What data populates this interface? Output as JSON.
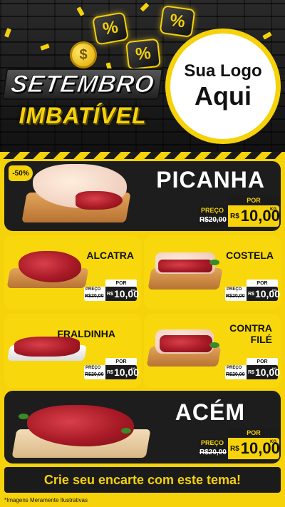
{
  "header": {
    "line1": "SETEMBRO",
    "line2": "IMBATÍVEL",
    "logo_line1": "Sua Logo",
    "logo_line2": "Aqui",
    "percent_symbol": "%",
    "coin_symbol": "$",
    "colors": {
      "accent": "#f5d20a",
      "dark": "#1b1b1b"
    }
  },
  "products": [
    {
      "name": "PICANHA",
      "badge": "-50%",
      "por": "POR",
      "preco": "PREÇO",
      "old": "R$20,00",
      "currency": "R$",
      "value": "10,00",
      "unit": "KG"
    },
    {
      "name": "ALCATRA",
      "por": "POR",
      "preco": "PREÇO",
      "old": "R$20,00",
      "currency": "R$",
      "value": "10,00",
      "unit": "KG"
    },
    {
      "name": "COSTELA",
      "por": "POR",
      "preco": "PREÇO",
      "old": "R$20,00",
      "currency": "R$",
      "value": "10,00",
      "unit": "KG"
    },
    {
      "name": "FRALDINHA",
      "por": "POR",
      "preco": "PREÇO",
      "old": "R$20,00",
      "currency": "R$",
      "value": "10,00",
      "unit": "KG"
    },
    {
      "name": "CONTRA FILÉ",
      "por": "POR",
      "preco": "PREÇO",
      "old": "R$20,00",
      "currency": "R$",
      "value": "10,00",
      "unit": "KG"
    },
    {
      "name": "ACÉM",
      "por": "POR",
      "preco": "PREÇO",
      "old": "R$20,00",
      "currency": "R$",
      "value": "10,00",
      "unit": "KG"
    }
  ],
  "cta": "Crie seu encarte com este tema!",
  "disclaimer": "*Imagens Meramente Ilustrativas"
}
